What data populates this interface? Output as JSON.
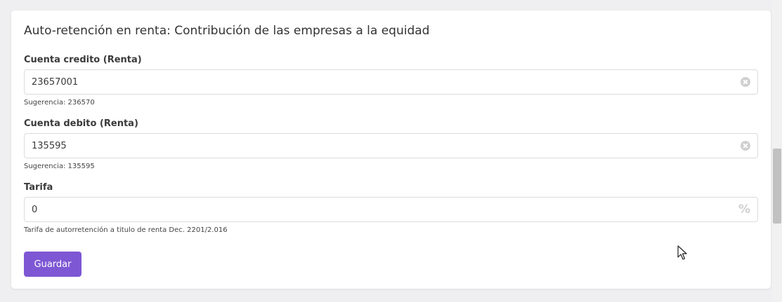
{
  "section": {
    "title": "Auto-retención en renta: Contribución de las empresas a la equidad"
  },
  "fields": {
    "credit_account": {
      "label": "Cuenta credito (Renta)",
      "value": "23657001",
      "hint": "Sugerencia: 236570",
      "icon": "clear-icon"
    },
    "debit_account": {
      "label": "Cuenta debito (Renta)",
      "value": "135595",
      "hint": "Sugerencia: 135595",
      "icon": "clear-icon"
    },
    "rate": {
      "label": "Tarifa",
      "value": "0",
      "unit": "%",
      "hint": "Tarifa de autorretención a titulo de renta Dec. 2201/2.016"
    }
  },
  "actions": {
    "save_label": "Guardar"
  },
  "colors": {
    "primary": "#7e57d4",
    "background": "#efeff1",
    "card": "#ffffff"
  }
}
